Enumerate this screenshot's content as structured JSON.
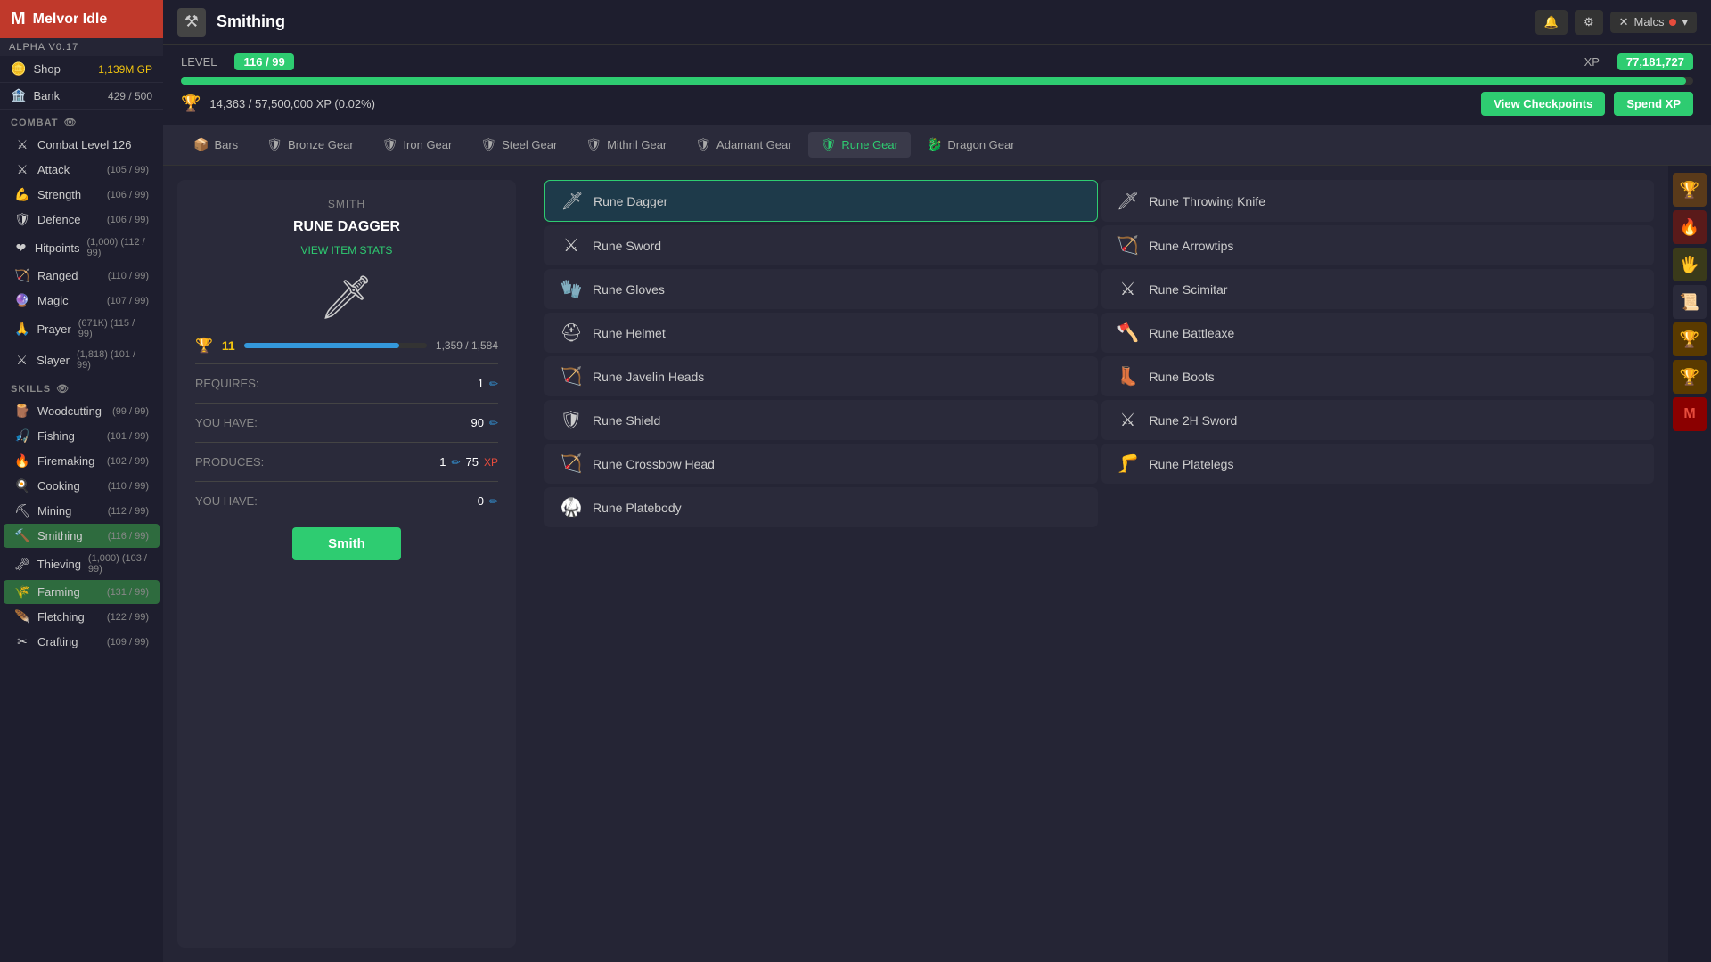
{
  "app": {
    "name": "Melvor Idle",
    "version": "ALPHA V0.17"
  },
  "topbar": {
    "title": "Smithing",
    "icon": "⚒",
    "user": "Malcs",
    "user_dot_color": "#e74c3c"
  },
  "sidebar": {
    "shop_label": "Shop",
    "shop_gp": "1,139M GP",
    "bank_label": "Bank",
    "bank_val": "429 / 500",
    "combat_label": "COMBAT",
    "combat_items": [
      {
        "name": "Combat Level 126",
        "level": "",
        "icon": "⚔"
      },
      {
        "name": "Attack",
        "level": "(105 / 99)",
        "icon": "⚔"
      },
      {
        "name": "Strength",
        "level": "(106 / 99)",
        "icon": "💪"
      },
      {
        "name": "Defence",
        "level": "(106 / 99)",
        "icon": "🛡"
      },
      {
        "name": "Hitpoints",
        "level": "(1,000) (112 / 99)",
        "icon": "❤"
      },
      {
        "name": "Ranged",
        "level": "(110 / 99)",
        "icon": "🏹"
      },
      {
        "name": "Magic",
        "level": "(107 / 99)",
        "icon": "🔮"
      },
      {
        "name": "Prayer",
        "level": "(671K) (115 / 99)",
        "icon": "🙏"
      },
      {
        "name": "Slayer",
        "level": "(1,818) (101 / 99)",
        "icon": "⚔"
      }
    ],
    "skills_label": "SKILLS",
    "skills_items": [
      {
        "name": "Woodcutting",
        "level": "(99 / 99)",
        "icon": "🪵"
      },
      {
        "name": "Fishing",
        "level": "(101 / 99)",
        "icon": "🎣"
      },
      {
        "name": "Firemaking",
        "level": "(102 / 99)",
        "icon": "🔥"
      },
      {
        "name": "Cooking",
        "level": "(110 / 99)",
        "icon": "🍳"
      },
      {
        "name": "Mining",
        "level": "(112 / 99)",
        "icon": "⛏"
      },
      {
        "name": "Smithing",
        "level": "(116 / 99)",
        "icon": "🔨",
        "active": true
      },
      {
        "name": "Thieving",
        "level": "(1,000) (103 / 99)",
        "icon": "🗝"
      },
      {
        "name": "Farming",
        "level": "(131 / 99)",
        "icon": "🌾",
        "active": true
      },
      {
        "name": "Fletching",
        "level": "(122 / 99)",
        "icon": "🪶"
      },
      {
        "name": "Crafting",
        "level": "(109 / 99)",
        "icon": "✂"
      }
    ]
  },
  "skill_header": {
    "level_label": "LEVEL",
    "level_val": "116 / 99",
    "xp_label": "XP",
    "xp_val": "77,181,727",
    "xp_current": 14363,
    "xp_needed": 57500000,
    "xp_percent": "0.02",
    "xp_bar_pct": 99.5,
    "mastery_text": "14,363 / 57,500,000 XP (0.02%)",
    "checkpoint_label": "View Checkpoints",
    "spend_xp_label": "Spend XP"
  },
  "tabs": [
    {
      "label": "Bars",
      "icon": "📦",
      "active": false
    },
    {
      "label": "Bronze Gear",
      "icon": "🛡",
      "active": false
    },
    {
      "label": "Iron Gear",
      "icon": "🛡",
      "active": false
    },
    {
      "label": "Steel Gear",
      "icon": "🛡",
      "active": false
    },
    {
      "label": "Mithril Gear",
      "icon": "🛡",
      "active": false
    },
    {
      "label": "Adamant Gear",
      "icon": "🛡",
      "active": false
    },
    {
      "label": "Rune Gear",
      "icon": "🛡",
      "active": true
    },
    {
      "label": "Dragon Gear",
      "icon": "🐉",
      "active": false
    }
  ],
  "smith_panel": {
    "label": "SMITH",
    "title": "RUNE DAGGER",
    "view_stats": "VIEW ITEM STATS",
    "icon": "🗡",
    "mastery_num": "11",
    "mastery_progress": 85,
    "mastery_current": "1,359",
    "mastery_max": "1,584",
    "requires_label": "REQUIRES:",
    "requires_val": "1",
    "you_have_label": "YOU HAVE:",
    "you_have_val": "90",
    "produces_label": "PRODUCES:",
    "produces_val": "1",
    "produces_gp": "75",
    "you_have2_label": "YOU HAVE:",
    "you_have2_val": "0",
    "smith_btn": "Smith"
  },
  "items": {
    "left_column": [
      {
        "name": "Rune Dagger",
        "icon": "🗡",
        "selected": true
      },
      {
        "name": "Rune Sword",
        "icon": "⚔"
      },
      {
        "name": "Rune Gloves",
        "icon": "🧤"
      },
      {
        "name": "Rune Helmet",
        "icon": "⛑"
      },
      {
        "name": "Rune Javelin Heads",
        "icon": "🏹"
      },
      {
        "name": "Rune Shield",
        "icon": "🛡"
      },
      {
        "name": "Rune Crossbow Head",
        "icon": "🏹"
      },
      {
        "name": "Rune Platebody",
        "icon": "🥋"
      }
    ],
    "right_column": [
      {
        "name": "Rune Throwing Knife",
        "icon": "🗡"
      },
      {
        "name": "Rune Arrowtips",
        "icon": "🏹"
      },
      {
        "name": "Rune Scimitar",
        "icon": "⚔"
      },
      {
        "name": "Rune Battleaxe",
        "icon": "🪓"
      },
      {
        "name": "Rune Boots",
        "icon": "👢"
      },
      {
        "name": "Rune 2H Sword",
        "icon": "⚔"
      },
      {
        "name": "Rune Platelegs",
        "icon": "🦵"
      }
    ]
  },
  "right_icons": [
    {
      "icon": "🏆",
      "class": "trophy"
    },
    {
      "icon": "🔥",
      "class": "fire"
    },
    {
      "icon": "🖐",
      "class": "hand"
    },
    {
      "icon": "📜",
      "class": "scroll"
    },
    {
      "icon": "🏆",
      "class": "trophy2"
    },
    {
      "icon": "🏆",
      "class": "trophy3"
    },
    {
      "icon": "M",
      "class": "red-m"
    }
  ]
}
